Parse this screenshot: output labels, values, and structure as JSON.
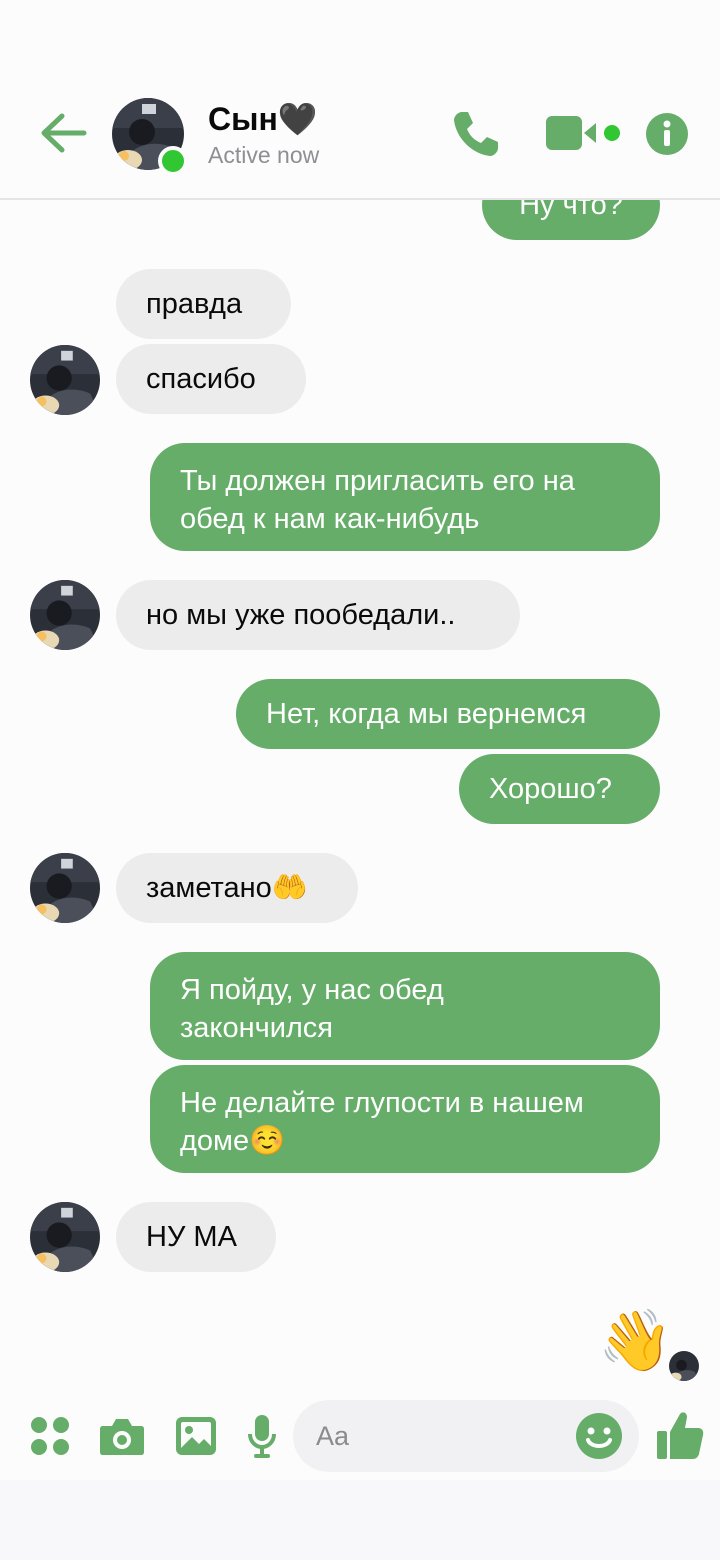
{
  "header": {
    "contact_name": "Сын🖤",
    "status": "Active now",
    "back_icon": "arrow-left-icon",
    "call_icon": "phone-icon",
    "video_icon": "video-camera-icon",
    "info_icon": "info-icon",
    "accent_color": "#65ad69"
  },
  "messages": [
    {
      "dir": "out",
      "text": "Ну что?"
    },
    {
      "dir": "in",
      "text": "правда"
    },
    {
      "dir": "in",
      "text": "спасибо"
    },
    {
      "dir": "out",
      "text": "Ты должен пригласить его на обед к нам как-нибудь"
    },
    {
      "dir": "in",
      "text": "но мы уже пообедали.."
    },
    {
      "dir": "out",
      "text": "Нет, когда мы вернемся"
    },
    {
      "dir": "out",
      "text": "Хорошо?"
    },
    {
      "dir": "in",
      "text": "заметано🤲"
    },
    {
      "dir": "out",
      "text": "Я пойду, у нас обед закончился"
    },
    {
      "dir": "out",
      "text": "Не делайте глупости в нашем доме☺️"
    },
    {
      "dir": "in",
      "text": "НУ МА"
    }
  ],
  "reaction": {
    "emoji": "👋"
  },
  "composer": {
    "placeholder": "Aa",
    "menu_icon": "apps-icon",
    "camera_icon": "camera-icon",
    "gallery_icon": "image-icon",
    "mic_icon": "microphone-icon",
    "emoji_icon": "smiley-icon",
    "like_icon": "thumbs-up-icon"
  },
  "colors": {
    "outgoing_bubble": "#65ad69",
    "incoming_bubble": "#ececed",
    "online": "#31c732"
  }
}
